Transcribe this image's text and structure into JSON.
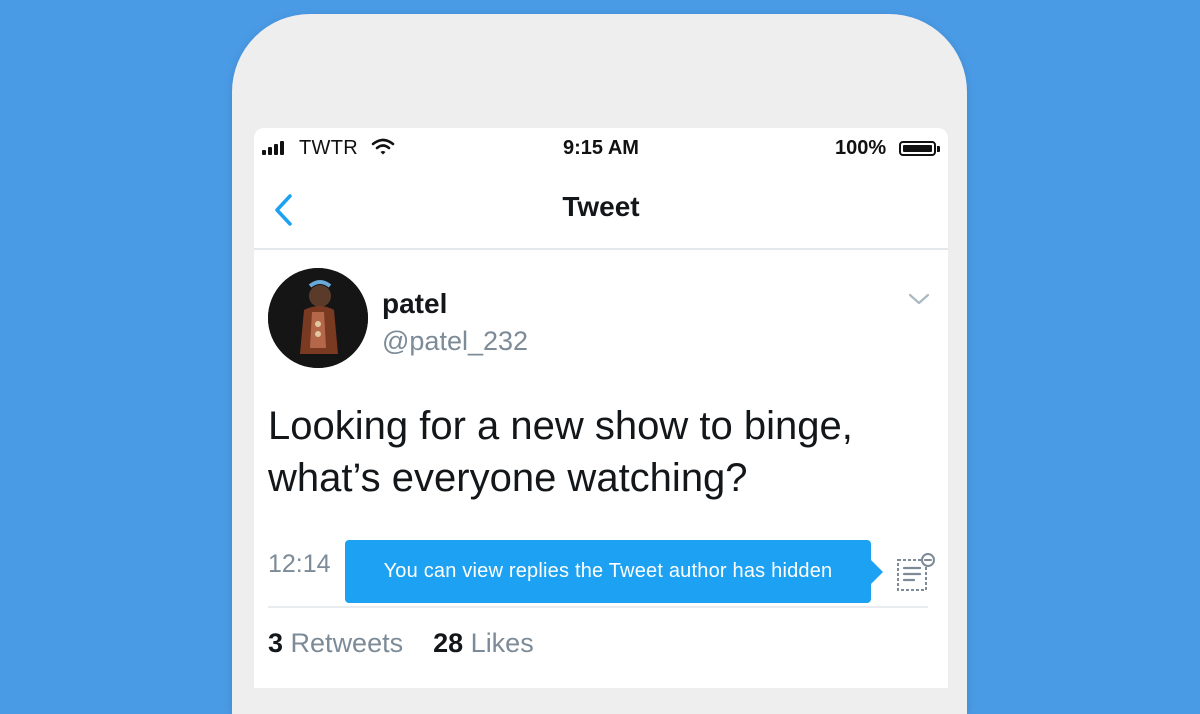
{
  "status_bar": {
    "carrier": "TWTR",
    "time": "9:15 AM",
    "battery": "100%"
  },
  "nav": {
    "title": "Tweet"
  },
  "tweet": {
    "author_name": "patel",
    "author_handle": "@patel_232",
    "text": "Looking for a new show to binge, what’s everyone watching?",
    "timestamp": "12:14",
    "retweets_count": "3",
    "retweets_label": "Retweets",
    "likes_count": "28",
    "likes_label": "Likes"
  },
  "tooltip": {
    "text": "You can view replies the Tweet author has hidden"
  },
  "icons": {
    "back": "chevron-left-icon",
    "more": "chevron-down-icon",
    "hidden_replies": "hidden-replies-icon",
    "signal": "signal-icon",
    "wifi": "wifi-icon",
    "battery": "battery-icon"
  },
  "colors": {
    "background": "#4a9be6",
    "accent": "#1da1f2",
    "text_secondary": "#7c8b97"
  }
}
